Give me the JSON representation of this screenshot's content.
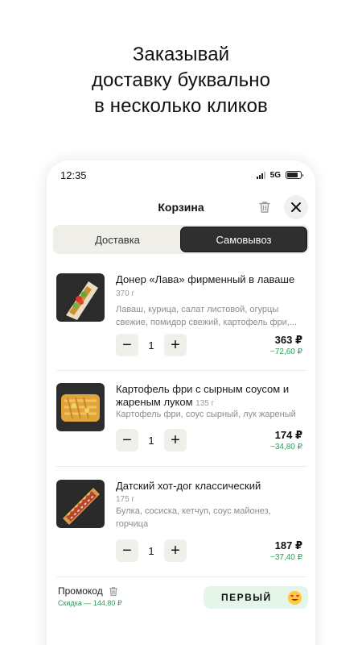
{
  "headline": {
    "line1": "Заказывай",
    "line2": "доставку буквально",
    "line3": "в несколько кликов"
  },
  "status_bar": {
    "time": "12:35",
    "network": "5G"
  },
  "header": {
    "title": "Корзина",
    "trash_icon": "trash-icon",
    "close_icon": "close-icon"
  },
  "tabs": [
    {
      "label": "Доставка",
      "active": false
    },
    {
      "label": "Самовывоз",
      "active": true
    }
  ],
  "items": [
    {
      "name": "Донер «Лава» фирменный в лаваше",
      "weight": "370 г",
      "desc_line1": "Лаваш, курица, салат листовой, огурцы",
      "desc_line2": "свежие, помидор свежий, картофель фри,...",
      "qty": "1",
      "price": "363 ₽",
      "discount": "−72,60 ₽"
    },
    {
      "name": "Картофель фри с сырным соусом и жареным луком",
      "weight": "135 г",
      "desc_line1": "Картофель фри, соус сырный, лук жареный",
      "desc_line2": "",
      "qty": "1",
      "price": "174 ₽",
      "discount": "−34,80 ₽"
    },
    {
      "name": "Датский хот-дог классический",
      "weight": "175 г",
      "desc_line1": "Булка, сосиска, кетчуп, соус майонез,",
      "desc_line2": "горчица",
      "qty": "1",
      "price": "187 ₽",
      "discount": "−37,40 ₽"
    }
  ],
  "stepper": {
    "minus": "−",
    "plus": "+"
  },
  "promo": {
    "label": "Промокод",
    "discount_text": "Скидка — 144,80 ₽",
    "code": "ПЕРВЫЙ",
    "emoji": "heart-eyes-emoji"
  },
  "colors": {
    "accent_green": "#27a05a",
    "promo_bg": "#e6f5ea",
    "active_tab": "#2f2f2f"
  }
}
